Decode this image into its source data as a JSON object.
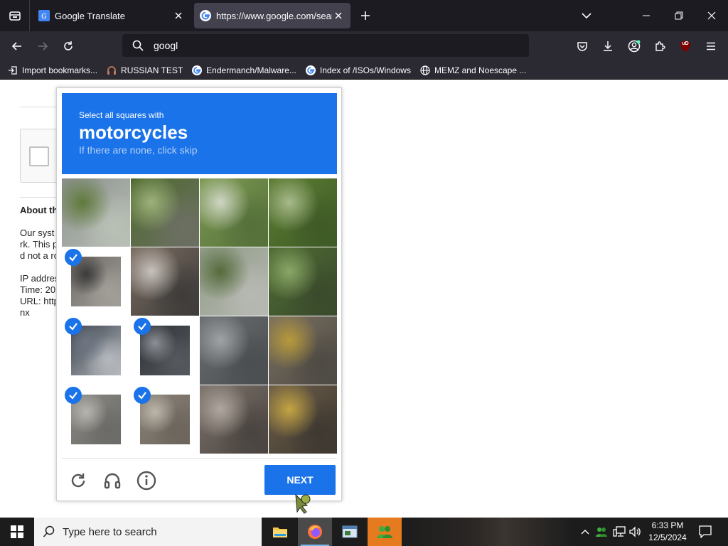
{
  "browser": {
    "tabs": [
      {
        "title": "Google Translate"
      },
      {
        "title": "https://www.google.com/search"
      }
    ],
    "url_value": "googl",
    "bookmarks": [
      {
        "label": "Import bookmarks..."
      },
      {
        "label": "RUSSIAN TEST"
      },
      {
        "label": "Endermanch/Malware..."
      },
      {
        "label": "Index of /ISOs/Windows"
      },
      {
        "label": "MEMZ and Noescape ..."
      }
    ],
    "extension_badge": "uD"
  },
  "page": {
    "about_heading": "About th",
    "paragraph_lines": [
      "Our syst",
      "rk. This p",
      "d not a ro"
    ],
    "info_lines": [
      "IP addres",
      "Time: 20",
      "URL: http",
      "nx"
    ]
  },
  "captcha": {
    "instruction": "Select all squares with",
    "target": "motorcycles",
    "hint": "If there are none, click skip",
    "next_label": "NEXT",
    "grid": [
      {
        "selected": false
      },
      {
        "selected": false
      },
      {
        "selected": false
      },
      {
        "selected": false
      },
      {
        "selected": true
      },
      {
        "selected": false
      },
      {
        "selected": false
      },
      {
        "selected": false
      },
      {
        "selected": true
      },
      {
        "selected": true
      },
      {
        "selected": false
      },
      {
        "selected": false
      },
      {
        "selected": true
      },
      {
        "selected": true
      },
      {
        "selected": false
      },
      {
        "selected": false
      }
    ]
  },
  "taskbar": {
    "search_placeholder": "Type here to search",
    "time": "6:33 PM",
    "date": "12/5/2024"
  },
  "colors": {
    "captcha_blue": "#1a73e8",
    "browser_dark": "#1c1b22",
    "browser_toolbar": "#2b2a33",
    "taskbar": "#1c1c1c"
  }
}
